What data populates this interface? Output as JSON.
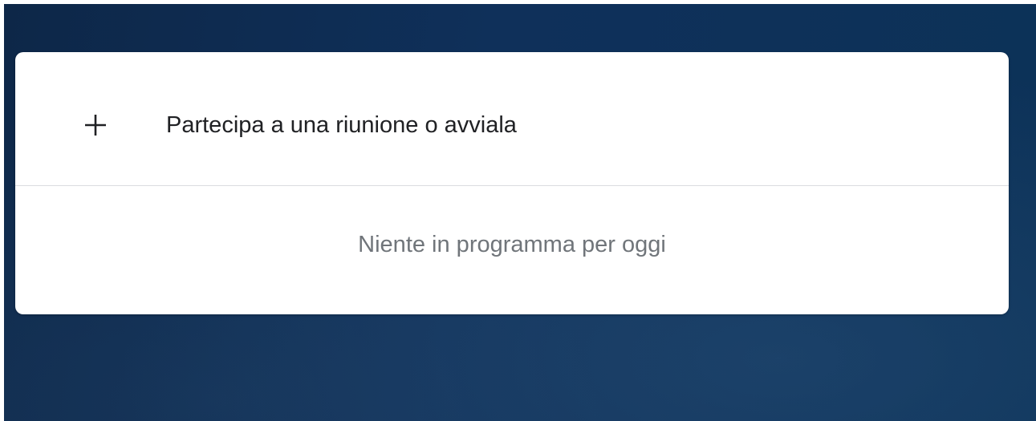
{
  "meeting_card": {
    "join_action": {
      "icon": "plus-icon",
      "label": "Partecipa a una riunione o avviala"
    },
    "empty_state": "Niente in programma per oggi"
  },
  "colors": {
    "background": "#0f305a",
    "card": "#ffffff",
    "primary_text": "#202124",
    "secondary_text": "#70757a",
    "divider": "#dadce0"
  }
}
